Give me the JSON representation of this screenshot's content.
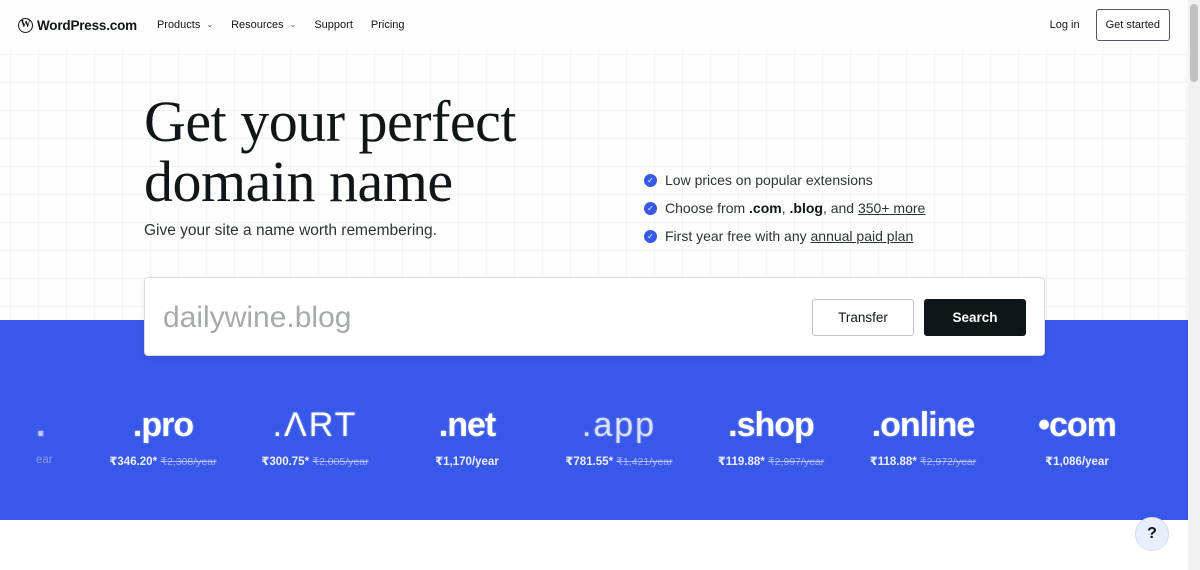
{
  "nav": {
    "logo": "WordPress.com",
    "links": [
      {
        "label": "Products",
        "has_dropdown": true
      },
      {
        "label": "Resources",
        "has_dropdown": true
      },
      {
        "label": "Support",
        "has_dropdown": false
      },
      {
        "label": "Pricing",
        "has_dropdown": false
      }
    ],
    "login": "Log in",
    "get_started": "Get started"
  },
  "hero": {
    "headline_line1": "Get your perfect",
    "headline_line2": "domain name",
    "subtitle": "Give your site a name worth remembering.",
    "features": [
      {
        "parts": [
          "Low prices on popular extensions"
        ]
      },
      {
        "pre": "Choose from ",
        "b1": ".com",
        "mid1": ", ",
        "b2": ".blog",
        "mid2": ", and ",
        "link": "350+ more"
      },
      {
        "pre": "First year free with any ",
        "link": "annual paid plan"
      }
    ]
  },
  "search": {
    "placeholder": "dailywine.blog",
    "transfer_label": "Transfer",
    "search_label": "Search"
  },
  "tlds": {
    "partial": {
      "price": "ear"
    },
    "items": [
      {
        "name": ".pro",
        "price": "₹346.20*",
        "old_price": "₹2,308/year"
      },
      {
        "name": ".ΛRT",
        "price": "₹300.75*",
        "old_price": "₹2,005/year"
      },
      {
        "name": ".net",
        "price": "₹1,170/year",
        "old_price": ""
      },
      {
        "name": ".app",
        "price": "₹781.55*",
        "old_price": "₹1,421/year"
      },
      {
        "name": ".shop",
        "price": "₹119.88*",
        "old_price": "₹2,997/year"
      },
      {
        "name": ".online",
        "price": "₹118.88*",
        "old_price": "₹2,972/year"
      },
      {
        "name": "•com",
        "price": "₹1,086/year",
        "old_price": ""
      }
    ]
  },
  "help": {
    "label": "?"
  },
  "colors": {
    "accent": "#3858e9",
    "dark": "#101517"
  },
  "icons": {
    "logo": "wordpress-logo-icon",
    "check": "check-circle-icon",
    "chevron": "chevron-down-icon"
  }
}
